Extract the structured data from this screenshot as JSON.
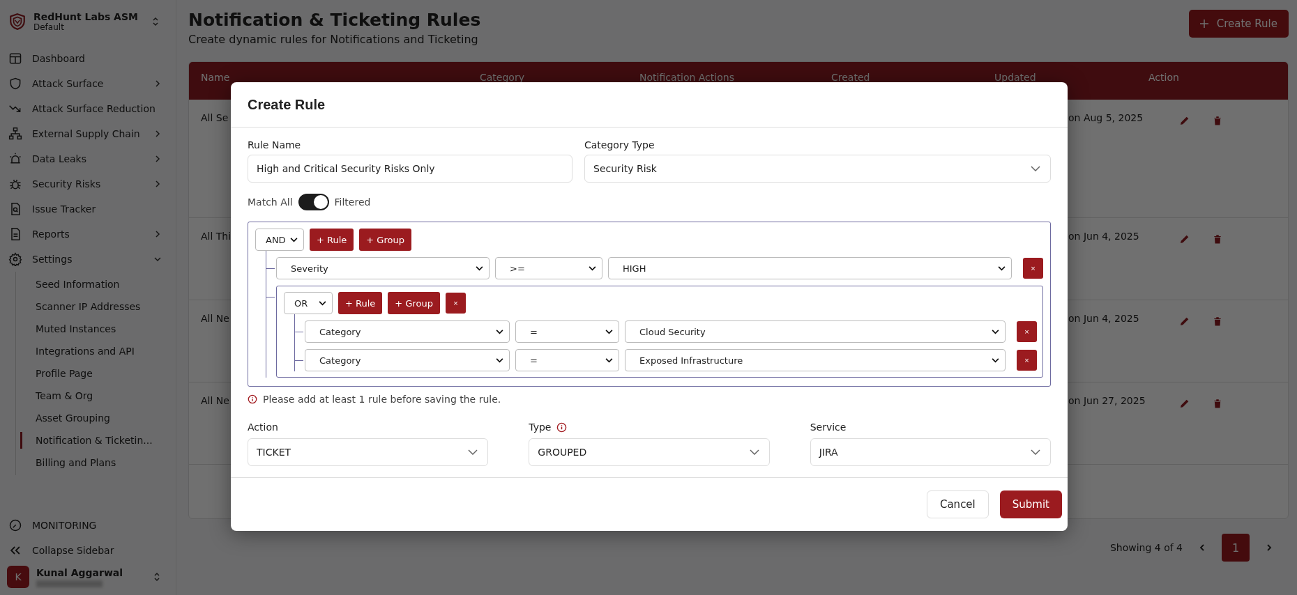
{
  "sidebar": {
    "org": {
      "name": "RedHunt Labs ASM",
      "workspace": "Default"
    },
    "items": [
      {
        "label": "Dashboard"
      },
      {
        "label": "Attack Surface",
        "expanded": false
      },
      {
        "label": "Attack Surface Reduction"
      },
      {
        "label": "External Supply Chain",
        "expanded": false
      },
      {
        "label": "Data Leaks",
        "expanded": false
      },
      {
        "label": "Security Risks",
        "expanded": false
      },
      {
        "label": "Issue Tracker"
      },
      {
        "label": "Reports",
        "expanded": false
      },
      {
        "label": "Settings",
        "expanded": true,
        "children": [
          {
            "label": "Seed Information",
            "selected": false
          },
          {
            "label": "Scanner IP Addresses",
            "selected": false
          },
          {
            "label": "Muted Instances",
            "selected": false
          },
          {
            "label": "Integrations and API",
            "selected": false
          },
          {
            "label": "Profile Page",
            "selected": false
          },
          {
            "label": "Team & Org",
            "selected": false
          },
          {
            "label": "Asset Grouping",
            "selected": false
          },
          {
            "label": "Notification & Ticketin...",
            "selected": true
          },
          {
            "label": "Billing and Plans",
            "selected": false
          }
        ]
      }
    ],
    "monitoring": "MONITORING",
    "collapse": "Collapse Sidebar",
    "user": {
      "initial": "K",
      "name": "Kunal Aggarwal"
    }
  },
  "page": {
    "title": "Notification & Ticketing Rules",
    "subtitle": "Create dynamic rules for Notifications and Ticketing",
    "create_button": "Create Rule"
  },
  "table": {
    "columns": [
      "Name",
      "Category",
      "Notification Actions",
      "Created",
      "Updated",
      "Action"
    ],
    "rows": [
      {
        "name": "All Se",
        "updated": "on Aug 5, 2025"
      },
      {
        "name": "All Thi",
        "updated": "on Jun 4, 2025"
      },
      {
        "name": "All Ne",
        "updated": "on Jun 4, 2025"
      },
      {
        "name": "All Ne",
        "updated": "on Jun 27, 2025"
      }
    ]
  },
  "pagination": {
    "summary": "Showing 4 of 4",
    "pages": [
      {
        "label": "1",
        "selected": true
      }
    ]
  },
  "modal": {
    "title": "Create Rule",
    "rule_name": {
      "label": "Rule Name",
      "value": "High and Critical Security Risks Only"
    },
    "category_type": {
      "label": "Category Type",
      "value": "Security Risk"
    },
    "match_toggle": {
      "off_label": "Match All",
      "on_label": "Filtered",
      "on": true
    },
    "query": {
      "conjunction": "AND",
      "add_rule": "+ Rule",
      "add_group": "+ Group",
      "rules": [
        {
          "kind": "rule",
          "field": "Severity",
          "operator": ">=",
          "value": "HIGH",
          "remove": "×"
        },
        {
          "kind": "group",
          "conjunction": "OR",
          "add_rule": "+ Rule",
          "add_group": "+ Group",
          "remove": "×",
          "rules": [
            {
              "kind": "rule",
              "field": "Category",
              "operator": "=",
              "value": "Cloud Security",
              "remove": "×"
            },
            {
              "kind": "rule",
              "field": "Category",
              "operator": "=",
              "value": "Exposed Infrastructure",
              "remove": "×"
            }
          ]
        }
      ]
    },
    "error": "Please add at least 1 rule before saving the rule.",
    "selects": [
      {
        "label": "Action",
        "value": "TICKET",
        "info": false
      },
      {
        "label": "Type",
        "value": "GROUPED",
        "info": true
      },
      {
        "label": "Service",
        "value": "JIRA",
        "info": false
      }
    ],
    "buttons": {
      "cancel": "Cancel",
      "submit": "Submit"
    }
  }
}
